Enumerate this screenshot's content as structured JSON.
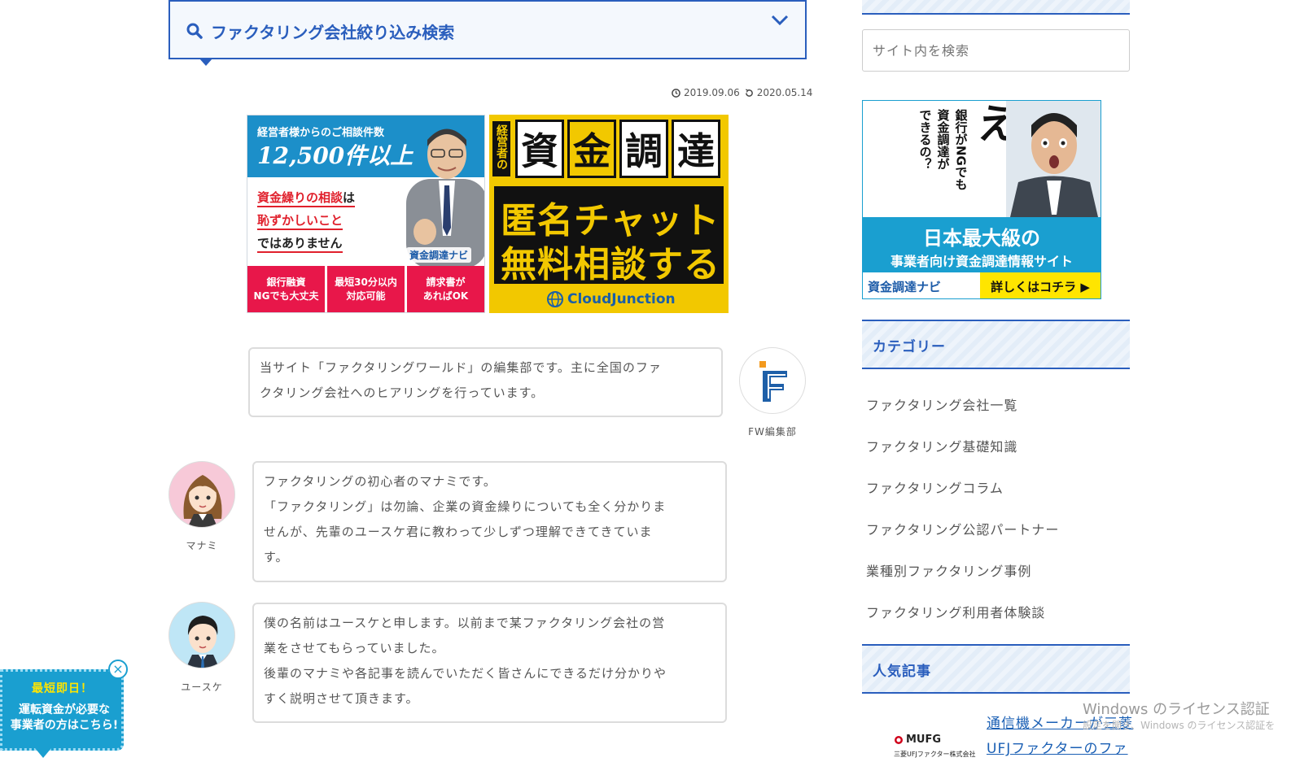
{
  "search": {
    "title": "ファクタリング会社絞り込み検索"
  },
  "dates": {
    "published": "2019.09.06",
    "updated": "2020.05.14"
  },
  "ad1": {
    "line1": "経営者様からのご相談件数",
    "line2": "12,500件以上",
    "copy1": "資金繰りの相談",
    "copy1b": "は",
    "copy2": "恥ずかしいこと",
    "copy3": "ではありません",
    "logo": "資金調達ナビ",
    "tags": [
      {
        "l1": "銀行融資",
        "l2": "NGでも大丈夫"
      },
      {
        "l1": "最短30分以内",
        "l2": "対応可能"
      },
      {
        "l1": "請求書が",
        "l2": "あればOK"
      }
    ]
  },
  "ad2": {
    "keiei": "経営者の",
    "chars": [
      "資",
      "金",
      "調",
      "達"
    ],
    "line1": "匿名チャット",
    "line2": "無料相談する",
    "brand": "CloudJunction"
  },
  "chats": {
    "editor": {
      "name": "FW編集部",
      "lines": [
        "当サイト「ファクタリングワールド」の編集部です。主に全国のファ",
        "クタリング会社へのヒアリングを行っています。"
      ]
    },
    "manami": {
      "name": "マナミ",
      "lines": [
        "ファクタリングの初心者のマナミです。",
        "「ファクタリング」は勿論、企業の資金繰りについても全く分かりま",
        "せんが、先輩のユースケ君に教わって少しずつ理解できてきていま",
        "す。"
      ]
    },
    "yusuke": {
      "name": "ユースケ",
      "lines": [
        "僕の名前はユースケと申します。以前まで某ファクタリング会社の営",
        "業をさせてもらっていました。",
        "後輩のマナミや各記事を読んでいただく皆さんにできるだけ分かりや",
        "すく説明させて頂きます。"
      ]
    }
  },
  "sidebar": {
    "search_placeholder": "サイト内を検索",
    "banner": {
      "q1": "銀行がNGでも",
      "q2": "資金調達が",
      "q3": "できるの？",
      "eh": "え!?",
      "big": "日本最大級の",
      "small": "事業者向け資金調達情報サイト",
      "logo": "資金調達ナビ",
      "cta": "詳しくはコチラ ▶"
    },
    "category_heading": "カテゴリー",
    "categories": [
      "ファクタリング会社一覧",
      "ファクタリング基礎知識",
      "ファクタリングコラム",
      "ファクタリング公認パートナー",
      "業種別ファクタリング事例",
      "ファクタリング利用者体験談"
    ],
    "popular_heading": "人気記事",
    "popular": {
      "thumb_logo": "MUFG",
      "thumb_sub": "三菱UFJファクター株式会社",
      "title_l1": "通信機メーカーが三菱",
      "title_l2": "UFJファクターのファ"
    }
  },
  "floating": {
    "heading": "最短即日！",
    "line1": "運転資金が必要な",
    "line2": "事業者の方はこちら!"
  },
  "windows": {
    "line1": "Windows のライセンス認証",
    "line2": "設定を開き、Windows のライセンス認証を"
  },
  "colors": {
    "accent": "#2a5ebd",
    "ad_yellow": "#f2c800",
    "ad_blue": "#1a9fd0",
    "tag_red": "#e8174a"
  }
}
